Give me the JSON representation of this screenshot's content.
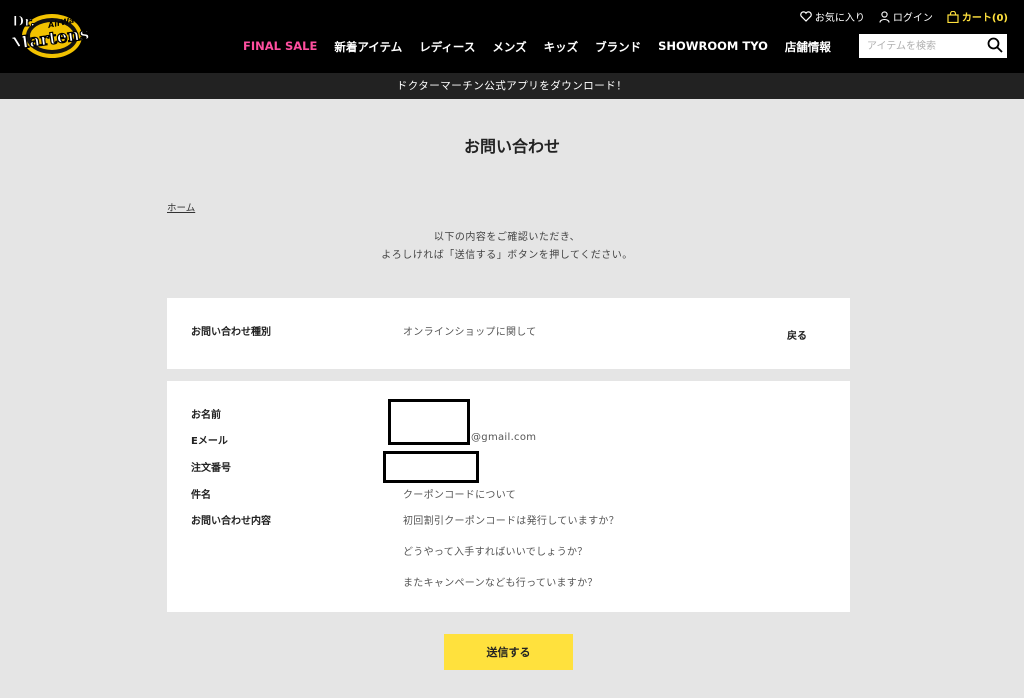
{
  "brand": {
    "logo_top": "Dr.",
    "logo_main": "Martens",
    "logo_script": "AirWair"
  },
  "util": {
    "favorites": "お気に入り",
    "login": "ログイン",
    "cart": "カート(0)"
  },
  "nav": {
    "items": [
      "FINAL SALE",
      "新着アイテム",
      "レディース",
      "メンズ",
      "キッズ",
      "ブランド",
      "SHOWROOM TYO",
      "店舗情報"
    ]
  },
  "search": {
    "placeholder": "アイテムを検索"
  },
  "banner": "ドクターマーチン公式アプリをダウンロード！",
  "page": {
    "title": "お問い合わせ",
    "breadcrumb": "ホーム",
    "intro_line1": "以下の内容をご確認いただき、",
    "intro_line2": "よろしければ「送信する」ボタンを押してください。"
  },
  "inquiry_type": {
    "label": "お問い合わせ種別",
    "value": "オンラインショップに関して",
    "back": "戻る"
  },
  "form": {
    "name_label": "お名前",
    "email_label": "Eメール",
    "email_value": "@gmail.com",
    "order_label": "注文番号",
    "subject_label": "件名",
    "subject_value": "クーポンコードについて",
    "content_label": "お問い合わせ内容",
    "content_line1": "初回割引クーポンコードは発行していますか？",
    "content_line2": "どうやって入手すればいいでしょうか？",
    "content_line3": "またキャンペーンなども行っていますか？"
  },
  "submit": "送信する",
  "colors": {
    "header": "#000000",
    "sale": "#ff4fa0",
    "accent": "#ffe13d",
    "background": "#e5e5e5"
  }
}
